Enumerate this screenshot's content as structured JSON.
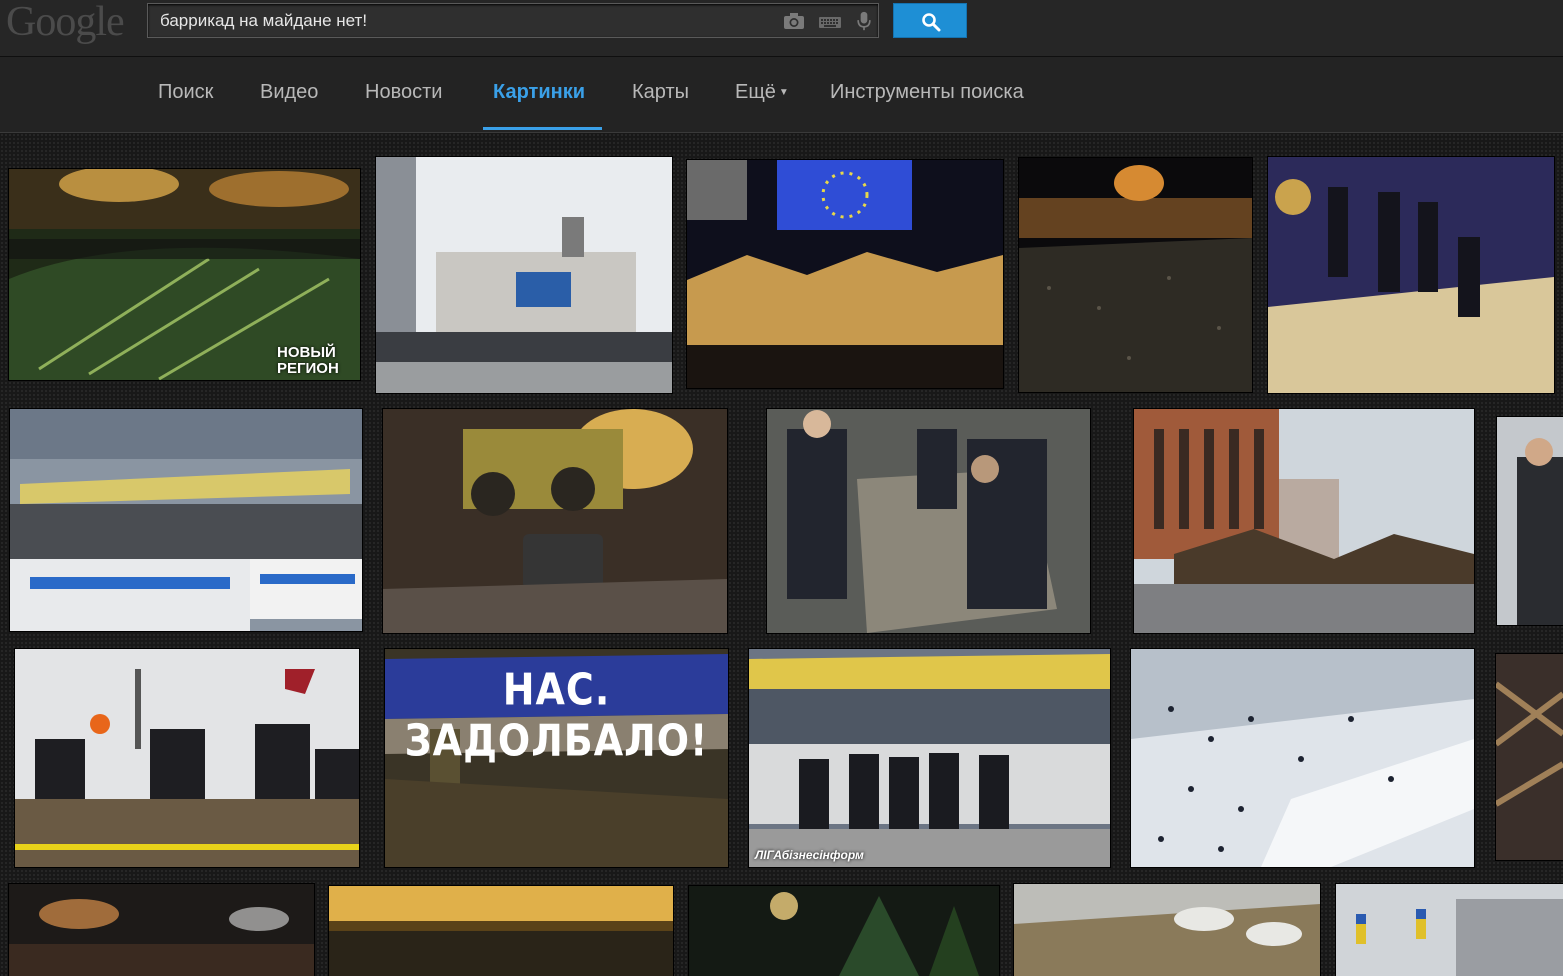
{
  "header": {
    "logo_text": "Google",
    "search_query": "баррикад на майдане нет!",
    "icons": [
      "camera-icon",
      "keyboard-icon",
      "microphone-icon",
      "search-icon"
    ],
    "accent_color": "#1e8fd5"
  },
  "nav": {
    "tabs": [
      {
        "label": "Поиск"
      },
      {
        "label": "Видео"
      },
      {
        "label": "Новости"
      },
      {
        "label": "Картинки",
        "active": true
      },
      {
        "label": "Карты"
      },
      {
        "label": "Ещё"
      },
      {
        "label": "Инструменты поиска"
      }
    ]
  },
  "results": {
    "watermarks": {
      "novy_region_line1": "НОВЫЙ",
      "novy_region_line2": "РЕГИОН",
      "liga": "ЛIГАбізнесінформ"
    },
    "banner_text": "НАС. ЗАДОЛБАЛО!"
  }
}
